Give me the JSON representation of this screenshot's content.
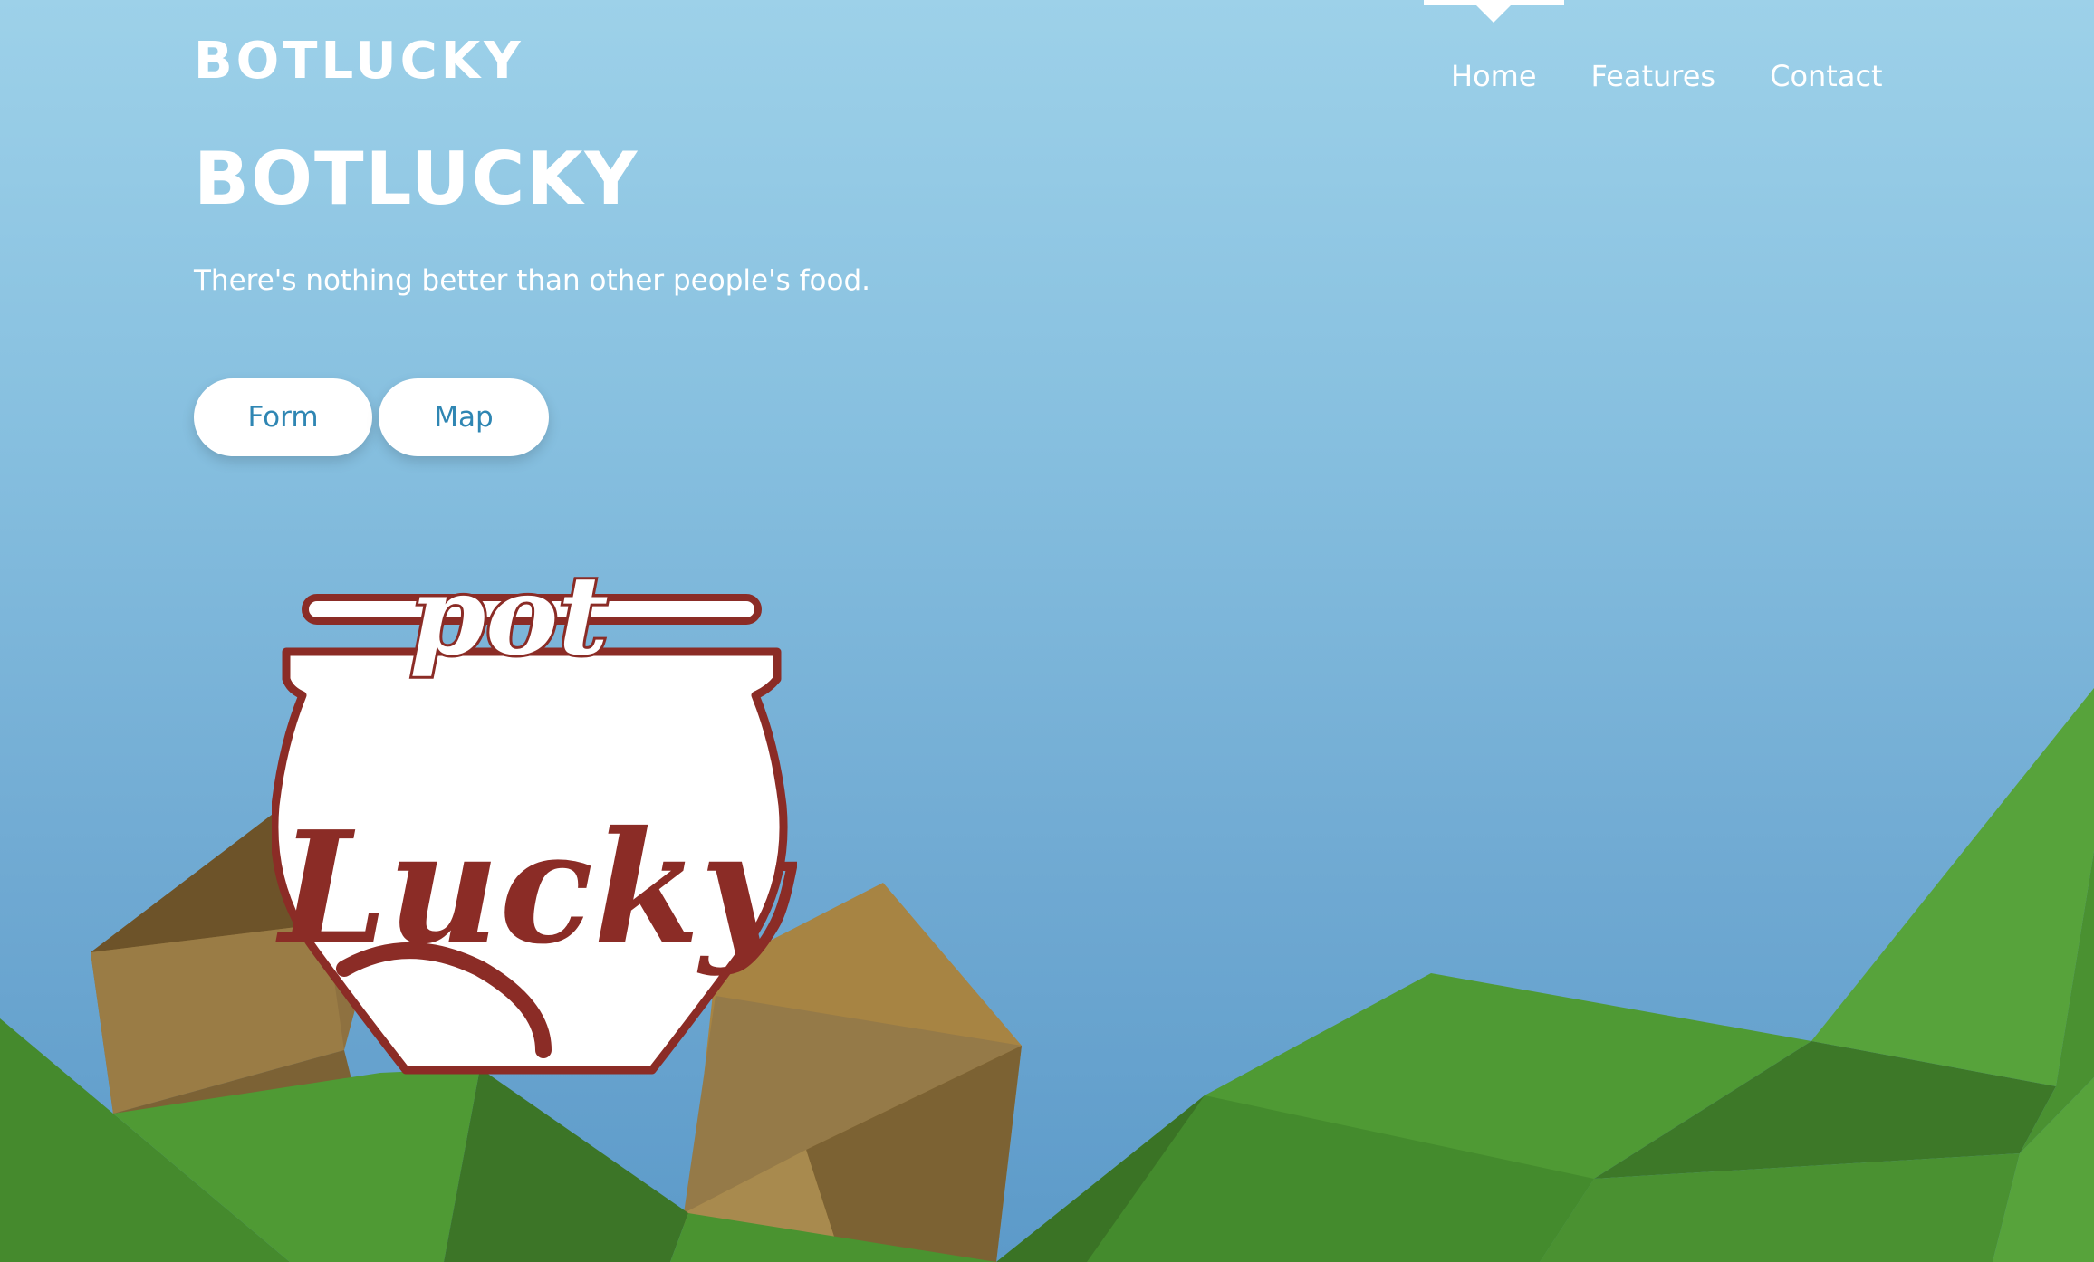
{
  "header": {
    "brand": "BOTLUCKY"
  },
  "nav": {
    "items": [
      {
        "label": "Home",
        "active": true
      },
      {
        "label": "Features",
        "active": false
      },
      {
        "label": "Contact",
        "active": false
      }
    ]
  },
  "hero": {
    "title": "BOTLUCKY",
    "subtitle": "There's nothing better than other people's food.",
    "buttons": {
      "form_label": "Form",
      "map_label": "Map"
    }
  },
  "logo": {
    "top_word": "pot",
    "main_word": "Lucky"
  },
  "colors": {
    "sky_top": "#9dd1e9",
    "sky_bottom": "#5c9ac9",
    "button_text": "#2f86b3",
    "logo_red": "#8b2c26",
    "grass": "#4f9a34",
    "rock": "#9a7c45"
  }
}
